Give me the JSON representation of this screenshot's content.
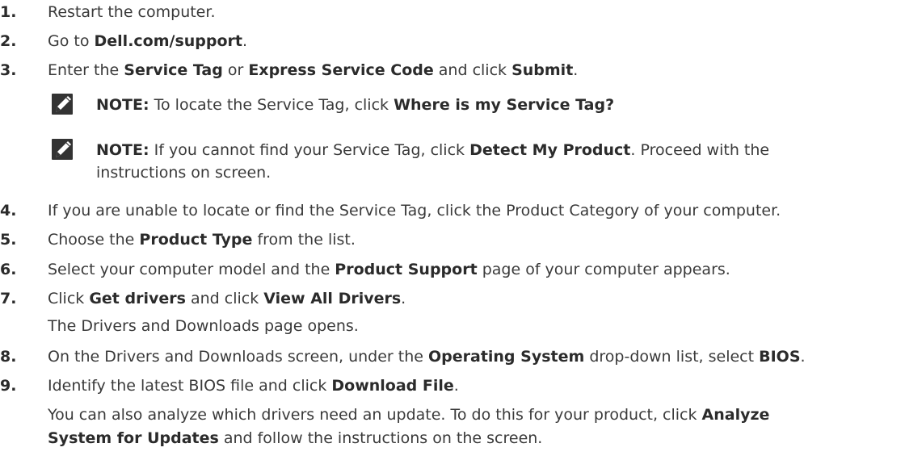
{
  "steps": [
    {
      "num": "1.",
      "parts": [
        {
          "t": "Restart the computer."
        }
      ]
    },
    {
      "num": "2.",
      "parts": [
        {
          "t": "Go to "
        },
        {
          "b": "Dell.com/support"
        },
        {
          "t": "."
        }
      ]
    },
    {
      "num": "3.",
      "parts": [
        {
          "t": "Enter the "
        },
        {
          "b": "Service Tag"
        },
        {
          "t": " or "
        },
        {
          "b": "Express Service Code"
        },
        {
          "t": " and click "
        },
        {
          "b": "Submit"
        },
        {
          "t": "."
        }
      ]
    },
    {
      "num": "4.",
      "parts": [
        {
          "t": "If you are unable to locate or find the Service Tag, click the Product Category of your computer."
        }
      ]
    },
    {
      "num": "5.",
      "parts": [
        {
          "t": "Choose the "
        },
        {
          "b": "Product Type"
        },
        {
          "t": " from the list."
        }
      ]
    },
    {
      "num": "6.",
      "parts": [
        {
          "t": "Select your computer model and the "
        },
        {
          "b": "Product Support"
        },
        {
          "t": " page of your computer appears."
        }
      ]
    },
    {
      "num": "7.",
      "parts": [
        {
          "t": "Click "
        },
        {
          "b": "Get drivers"
        },
        {
          "t": " and click "
        },
        {
          "b": "View All Drivers"
        },
        {
          "t": "."
        }
      ]
    },
    {
      "num": "8.",
      "parts": [
        {
          "t": "On the Drivers and Downloads screen, under the "
        },
        {
          "b": "Operating System"
        },
        {
          "t": " drop-down list, select "
        },
        {
          "b": "BIOS"
        },
        {
          "t": "."
        }
      ]
    },
    {
      "num": "9.",
      "parts": [
        {
          "t": "Identify the latest BIOS file and click "
        },
        {
          "b": "Download File"
        },
        {
          "t": "."
        }
      ]
    }
  ],
  "notes": [
    {
      "label": "NOTE:",
      "lines": [
        [
          {
            "t": " To locate the Service Tag, click "
          },
          {
            "b": "Where is my Service Tag?"
          }
        ]
      ]
    },
    {
      "label": "NOTE:",
      "lines": [
        [
          {
            "t": " If you cannot find your Service Tag, click "
          },
          {
            "b": "Detect My Product"
          },
          {
            "t": ". Proceed with the"
          }
        ],
        [
          {
            "t": "instructions on screen."
          }
        ]
      ]
    }
  ],
  "continuations": {
    "step7": [
      [
        {
          "t": "The Drivers and Downloads page opens."
        }
      ]
    ],
    "step9": [
      [
        {
          "t": "You can also analyze which drivers need an update. To do this for your product, click "
        },
        {
          "b": "Analyze"
        }
      ],
      [
        {
          "b": "System for Updates"
        },
        {
          "t": " and follow the instructions on the screen."
        }
      ]
    ]
  },
  "icons": {
    "note": "pencil-note-icon"
  }
}
